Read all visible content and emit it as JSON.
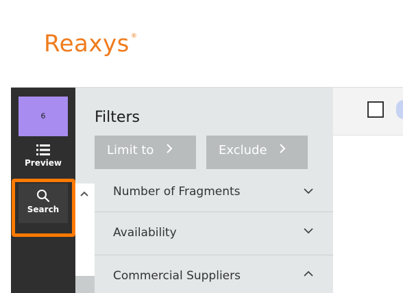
{
  "app": {
    "logo": "Reaxys",
    "logo_mark": "®"
  },
  "sidebar": {
    "selected_count": "6",
    "preview_label": "Preview",
    "search_label": "Search"
  },
  "filters": {
    "title": "Filters",
    "limit_label": "Limit to",
    "exclude_label": "Exclude",
    "facets": [
      {
        "label": "Number of Fragments",
        "state": "collapsed"
      },
      {
        "label": "Availability",
        "state": "collapsed"
      },
      {
        "label": "Commercial Suppliers",
        "state": "expanded"
      }
    ]
  },
  "colors": {
    "brand": "#f07b1d",
    "highlight": "#ff7a00",
    "selection_badge": "#a88cf0",
    "sidebar": "#2f2f2f",
    "filters_panel": "#e3e7e7"
  }
}
